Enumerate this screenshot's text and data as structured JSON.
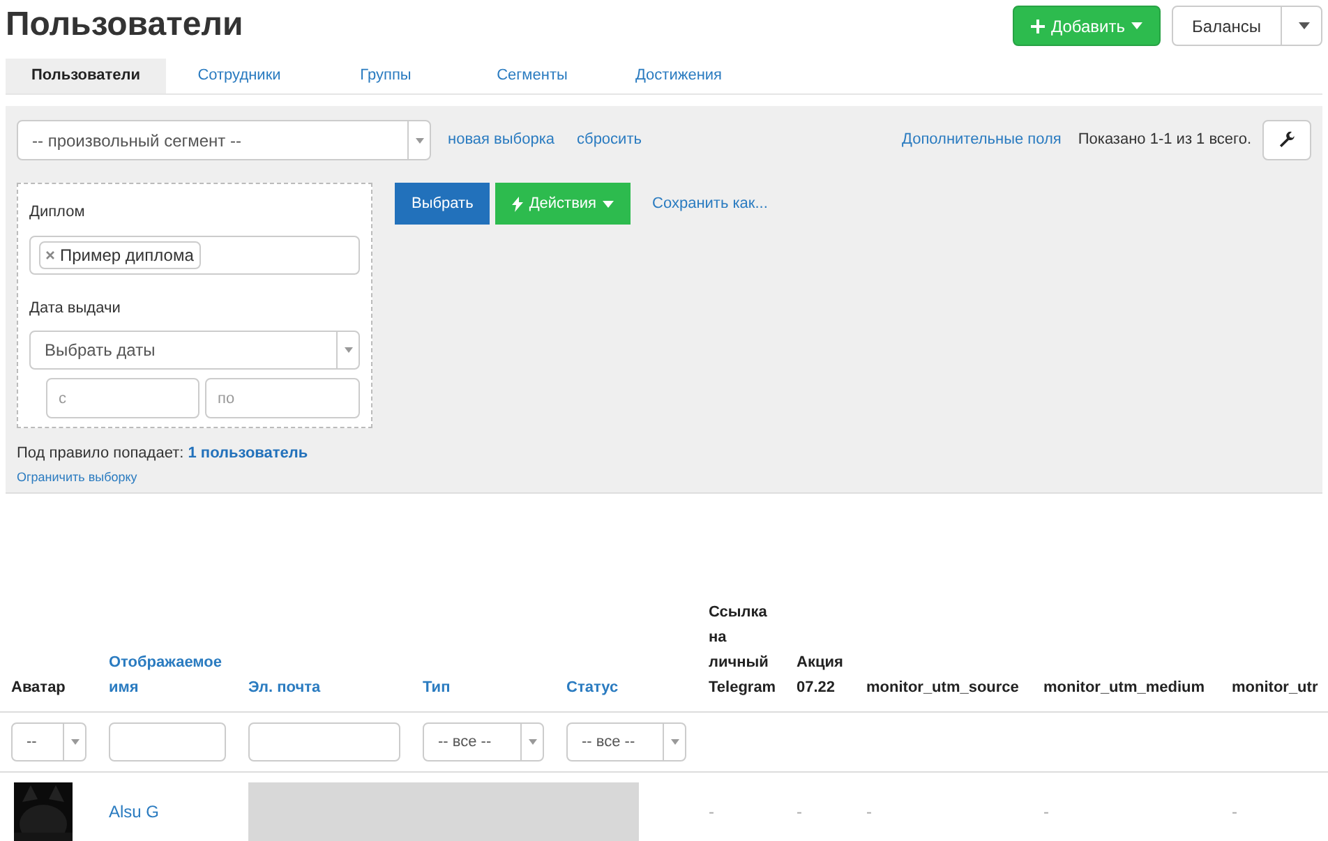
{
  "title": "Пользователи",
  "header_buttons": {
    "add": "Добавить",
    "balances": "Балансы"
  },
  "tabs": [
    {
      "label": "Пользователи",
      "selected": true
    },
    {
      "label": "Сотрудники",
      "selected": false
    },
    {
      "label": "Группы",
      "selected": false
    },
    {
      "label": "Сегменты",
      "selected": false
    },
    {
      "label": "Достижения",
      "selected": false
    }
  ],
  "filter_bar": {
    "segment_select": "-- произвольный сегмент --",
    "new_selection": "новая выборка",
    "reset": "сбросить",
    "extra_fields": "Дополнительные поля",
    "shown": "Показано 1-1 из 1 всего."
  },
  "rule": {
    "diploma_label": "Диплом",
    "diploma_tags": [
      "Пример диплома"
    ],
    "date_label": "Дата выдачи",
    "date_select": "Выбрать даты",
    "from_placeholder": "с",
    "to_placeholder": "по"
  },
  "actions": {
    "select": "Выбрать",
    "actions": "Действия",
    "save_as": "Сохранить как..."
  },
  "match": {
    "text": "Под правило попадает: **1 пользователь**",
    "limit": "Ограничить выборку"
  },
  "table": {
    "columns": [
      {
        "label": "Аватар",
        "sortable": false
      },
      {
        "label": "Отображаемое имя",
        "sortable": true
      },
      {
        "label": "Эл. почта",
        "sortable": true
      },
      {
        "label": "Тип",
        "sortable": true
      },
      {
        "label": "Статус",
        "sortable": true
      },
      {
        "label": "Ссылка на личный Telegram",
        "sortable": false
      },
      {
        "label": "Акция 07.22",
        "sortable": false
      },
      {
        "label": "monitor_utm_source",
        "sortable": false
      },
      {
        "label": "monitor_utm_medium",
        "sortable": false
      },
      {
        "label": "monitor_utr",
        "sortable": false
      }
    ],
    "filters": [
      {
        "kind": "select",
        "value": "--"
      },
      {
        "kind": "input"
      },
      {
        "kind": "input"
      },
      {
        "kind": "select",
        "value": "-- все --"
      },
      {
        "kind": "select",
        "value": "-- все --"
      }
    ],
    "rows": [
      {
        "cells": [
          {
            "kind": "picture"
          },
          {
            "kind": "link",
            "text": "Alsu G"
          },
          {
            "kind": "redacted"
          },
          {
            "kind": "redacted"
          },
          {
            "kind": "redacted"
          },
          {
            "kind": "text",
            "text": "-"
          },
          {
            "kind": "text",
            "text": "-"
          },
          {
            "kind": "text",
            "text": "-"
          },
          {
            "kind": "text",
            "text": "-"
          },
          {
            "kind": "text",
            "text": "-"
          }
        ]
      }
    ]
  }
}
